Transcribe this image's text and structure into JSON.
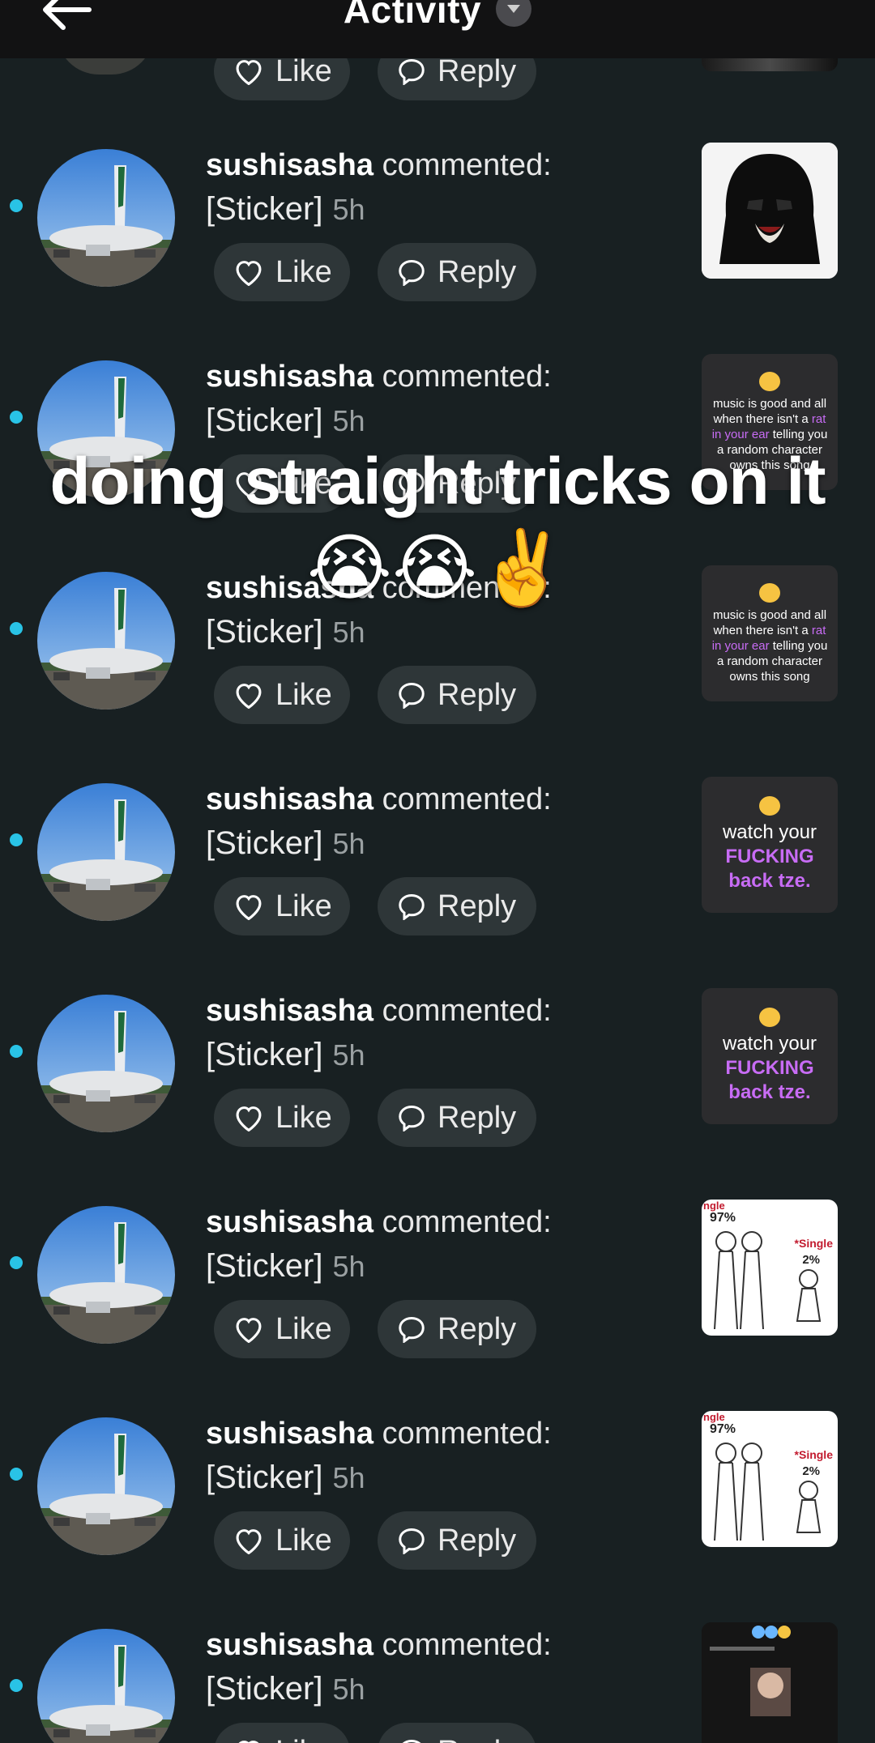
{
  "header": {
    "title": "Activity"
  },
  "overlay": {
    "line1": "doing straight tricks on it",
    "line2": "😭😭✌️"
  },
  "rows": [
    {
      "username": "sushisasha",
      "action": "commented:",
      "text": "[Sticker]",
      "time": "5h",
      "like": "Like",
      "reply": "Reply",
      "thumb": "darth-vader",
      "thumb_text": ""
    },
    {
      "username": "sushisasha",
      "action": "commented:",
      "text": "[Sticker]",
      "time": "5h",
      "like": "Like",
      "reply": "Reply",
      "thumb": "text-small",
      "thumb_parts": [
        "music is good and all when there isn't a ",
        "rat in your ear",
        " telling you a random character owns this song"
      ]
    },
    {
      "username": "sushisasha",
      "action": "commented:",
      "text": "[Sticker]",
      "time": "5h",
      "like": "Like",
      "reply": "Reply",
      "thumb": "text-small",
      "thumb_parts": [
        "music is good and all when there isn't a ",
        "rat in your ear",
        " telling you a random character owns this song"
      ]
    },
    {
      "username": "sushisasha",
      "action": "commented:",
      "text": "[Sticker]",
      "time": "5h",
      "like": "Like",
      "reply": "Reply",
      "thumb": "text-big",
      "thumb_parts": [
        "watch your",
        "FUCKING",
        "back tze."
      ]
    },
    {
      "username": "sushisasha",
      "action": "commented:",
      "text": "[Sticker]",
      "time": "5h",
      "like": "Like",
      "reply": "Reply",
      "thumb": "text-big",
      "thumb_parts": [
        "watch your",
        "FUCKING",
        "back tze."
      ]
    },
    {
      "username": "sushisasha",
      "action": "commented:",
      "text": "[Sticker]",
      "time": "5h",
      "like": "Like",
      "reply": "Reply",
      "thumb": "meme",
      "thumb_parts": [
        "ngle",
        "97%",
        "*Single",
        "2%"
      ]
    },
    {
      "username": "sushisasha",
      "action": "commented:",
      "text": "[Sticker]",
      "time": "5h",
      "like": "Like",
      "reply": "Reply",
      "thumb": "meme",
      "thumb_parts": [
        "ngle",
        "97%",
        "*Single",
        "2%"
      ]
    },
    {
      "username": "sushisasha",
      "action": "commented:",
      "text": "[Sticker]",
      "time": "5h",
      "like": "Like",
      "reply": "Reply",
      "thumb": "screenshot"
    }
  ],
  "top_partial": {
    "like": "Like",
    "reply": "Reply"
  },
  "colors": {
    "background": "#182022",
    "unread_dot": "#29c3e6",
    "notif_dot": "#fe2c55",
    "pill": "#2e3638",
    "accent_pink": "#c86cf5"
  }
}
